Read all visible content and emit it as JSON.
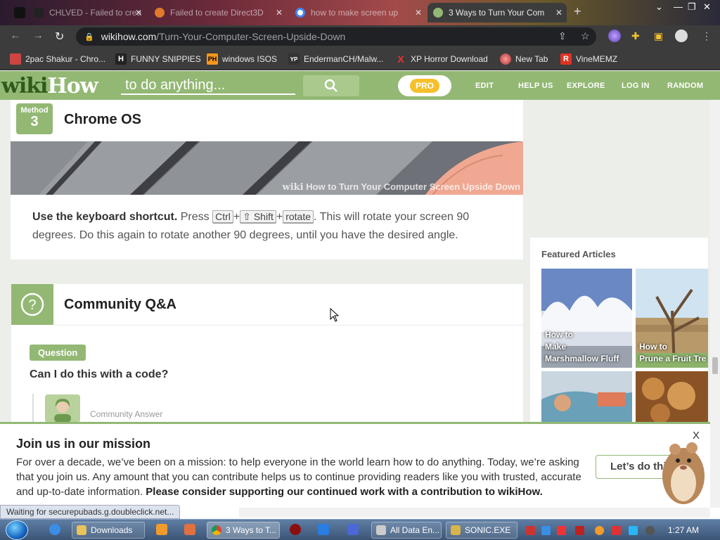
{
  "browser": {
    "tabs": [
      {
        "title": "CHLVED - Failed to crea"
      },
      {
        "title": "Failed to create Direct3D"
      },
      {
        "title": "how to make screen up"
      },
      {
        "title": "3 Ways to Turn Your Com"
      }
    ],
    "new_tab_glyph": "+",
    "url_host": "wikihow.com",
    "url_path": "/Turn-Your-Computer-Screen-Upside-Down",
    "bookmarks": [
      {
        "label": "2pac Shakur - Chro..."
      },
      {
        "label": "FUNNY SNIPPIES",
        "icon_text": "H"
      },
      {
        "label": "windows ISOS",
        "icon_text": "PH"
      },
      {
        "label": "EndermanCH/Malw...",
        "icon_text": "YP"
      },
      {
        "label": "XP Horror Download",
        "icon_text": "X"
      },
      {
        "label": "New Tab"
      },
      {
        "label": "VineMEMZ",
        "icon_text": "R"
      }
    ],
    "status_text": "Waiting for securepubads.g.doubleclick.net..."
  },
  "header": {
    "logo_wiki": "wiki",
    "logo_how": "How",
    "search_placeholder": "to do anything...",
    "pro_label": "PRO",
    "nav": [
      "EDIT",
      "HELP US",
      "EXPLORE",
      "LOG IN",
      "RANDOM"
    ]
  },
  "method": {
    "badge_label": "Method",
    "number": "3",
    "title": "Chrome OS",
    "image_caption_wiki": "wiki",
    "image_caption_rest": "How to Turn Your Computer Screen Upside Down",
    "step_bold": "Use the keyboard shortcut.",
    "step_press": "Press",
    "keys": [
      "Ctrl",
      "⇧ Shift",
      "rotate"
    ],
    "plus": "+",
    "step_rest": ". This will rotate your screen 90 degrees. Do this again to rotate another 90 degrees, until you have the desired angle."
  },
  "qa": {
    "icon_glyph": "?",
    "title": "Community Q&A",
    "question_badge": "Question",
    "question": "Can I do this with a code?",
    "answer_label": "Community Answer"
  },
  "sidebar": {
    "title": "Featured Articles",
    "articles": [
      {
        "line1": "How to",
        "line2": "Make",
        "line3": "Marshmallow Fluff"
      },
      {
        "line1": "How to",
        "line2": "Prune a Fruit Tre"
      }
    ]
  },
  "banner": {
    "title": "Join us in our mission",
    "text": "For over a decade, we’ve been on a mission: to help everyone in the world learn how to do anything. Today, we’re asking that you join us. Any amount that you can contribute helps us to continue providing readers like you with trusted, accurate and up-to-date information.",
    "text_bold": "Please consider supporting our continued work with a contribution to wikiHow.",
    "button_label": "Let’s do this",
    "close_glyph": "X"
  },
  "taskbar": {
    "items": [
      {
        "label": "Downloads"
      },
      {
        "label": "3 Ways to T..."
      },
      {
        "label": "All Data En..."
      },
      {
        "label": "SONIC.EXE"
      }
    ],
    "clock": "1:27 AM"
  },
  "colors": {
    "wikihow_green": "#93b874",
    "logo_dark_green": "#2f5a1c",
    "pro_yellow": "#f5c02b"
  }
}
